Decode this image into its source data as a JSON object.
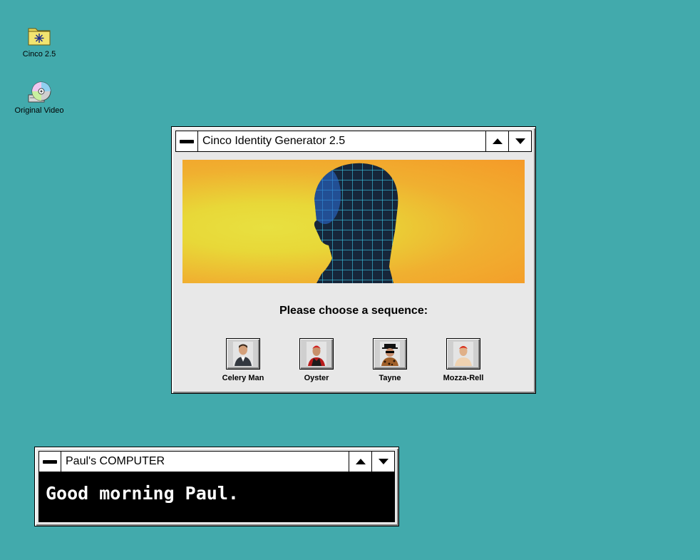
{
  "desktop": {
    "icons": [
      {
        "label": "Cinco 2.5",
        "icon": "folder-icon"
      },
      {
        "label": "Original Video",
        "icon": "cd-icon"
      }
    ]
  },
  "cinco_window": {
    "title": "Cinco Identity Generator 2.5",
    "prompt": "Please choose a sequence:",
    "sequences": [
      {
        "label": "Celery Man"
      },
      {
        "label": "Oyster"
      },
      {
        "label": "Tayne"
      },
      {
        "label": "Mozza-Rell"
      }
    ]
  },
  "pauls_window": {
    "title": "Paul's COMPUTER",
    "message": "Good morning Paul."
  },
  "colors": {
    "desktop_bg": "#42aaac",
    "window_bg": "#e8e8e8",
    "banner_yellow": "#e8e040",
    "banner_orange": "#f59a28",
    "grid_cyan": "#3cc8e8"
  }
}
